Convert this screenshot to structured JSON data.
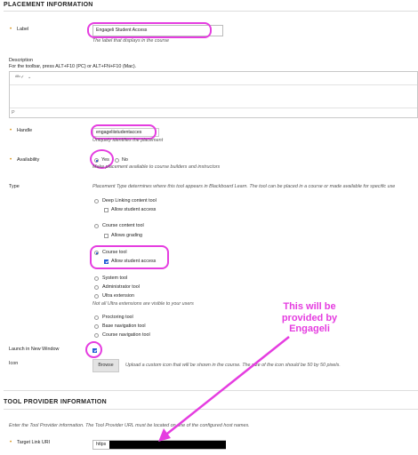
{
  "colors": {
    "accent_highlight": "#e53de0",
    "required_star": "#d58a00",
    "checkbox_blue": "#1f5cd6",
    "redaction": "#000000"
  },
  "placement": {
    "heading": "PLACEMENT INFORMATION",
    "label": {
      "label": "Label",
      "value": "Engageli Student Access",
      "hint": "The label that displays in the course"
    },
    "description": {
      "label": "Description",
      "toolbar_hint": "For the toolbar, press ALT+F10 (PC) or ALT+FN+F10 (Mac).",
      "path": "P"
    },
    "handle": {
      "label": "Handle",
      "value": "engageliistudentacces",
      "hint": "Uniquely identifies the placement"
    },
    "availability": {
      "label": "Availability",
      "yes": "Yes",
      "no": "No",
      "hint": "Make placement available to course builders and instructors"
    },
    "type": {
      "label": "Type",
      "hint": "Placement Type determines where this tool appears in Blackboard Learn. The tool can be placed in a course or made available for specific use",
      "deep_linking": "Deep Linking content tool",
      "deep_allow": "Allow student access",
      "course_content": "Course content tool",
      "allows_grading": "Allows grading",
      "course_tool": "Course tool",
      "course_allow": "Allow student access",
      "system_tool": "System tool",
      "admin_tool": "Administrator tool",
      "ultra_ext": "Ultra extension",
      "ultra_note": "Not all Ultra extensions are visible to your users",
      "proctoring": "Proctoring tool",
      "base_nav": "Base navigation tool",
      "course_nav": "Course navigation tool"
    },
    "launch": {
      "label": "Launch in New Window"
    },
    "icon": {
      "label": "Icon",
      "button": "Browse",
      "hint": "Upload a custom icon that will be shown in the course. The size of the icon should be 50 by 50 pixels."
    }
  },
  "provider": {
    "heading": "TOOL PROVIDER INFORMATION",
    "intro": "Enter the Tool Provider information. The Tool Provider URL must be located on one of the configured host names.",
    "target": {
      "label": "Target Link URI",
      "value": "https"
    }
  },
  "annotation": {
    "text": "This will be\nprovided by\nEngageli"
  }
}
